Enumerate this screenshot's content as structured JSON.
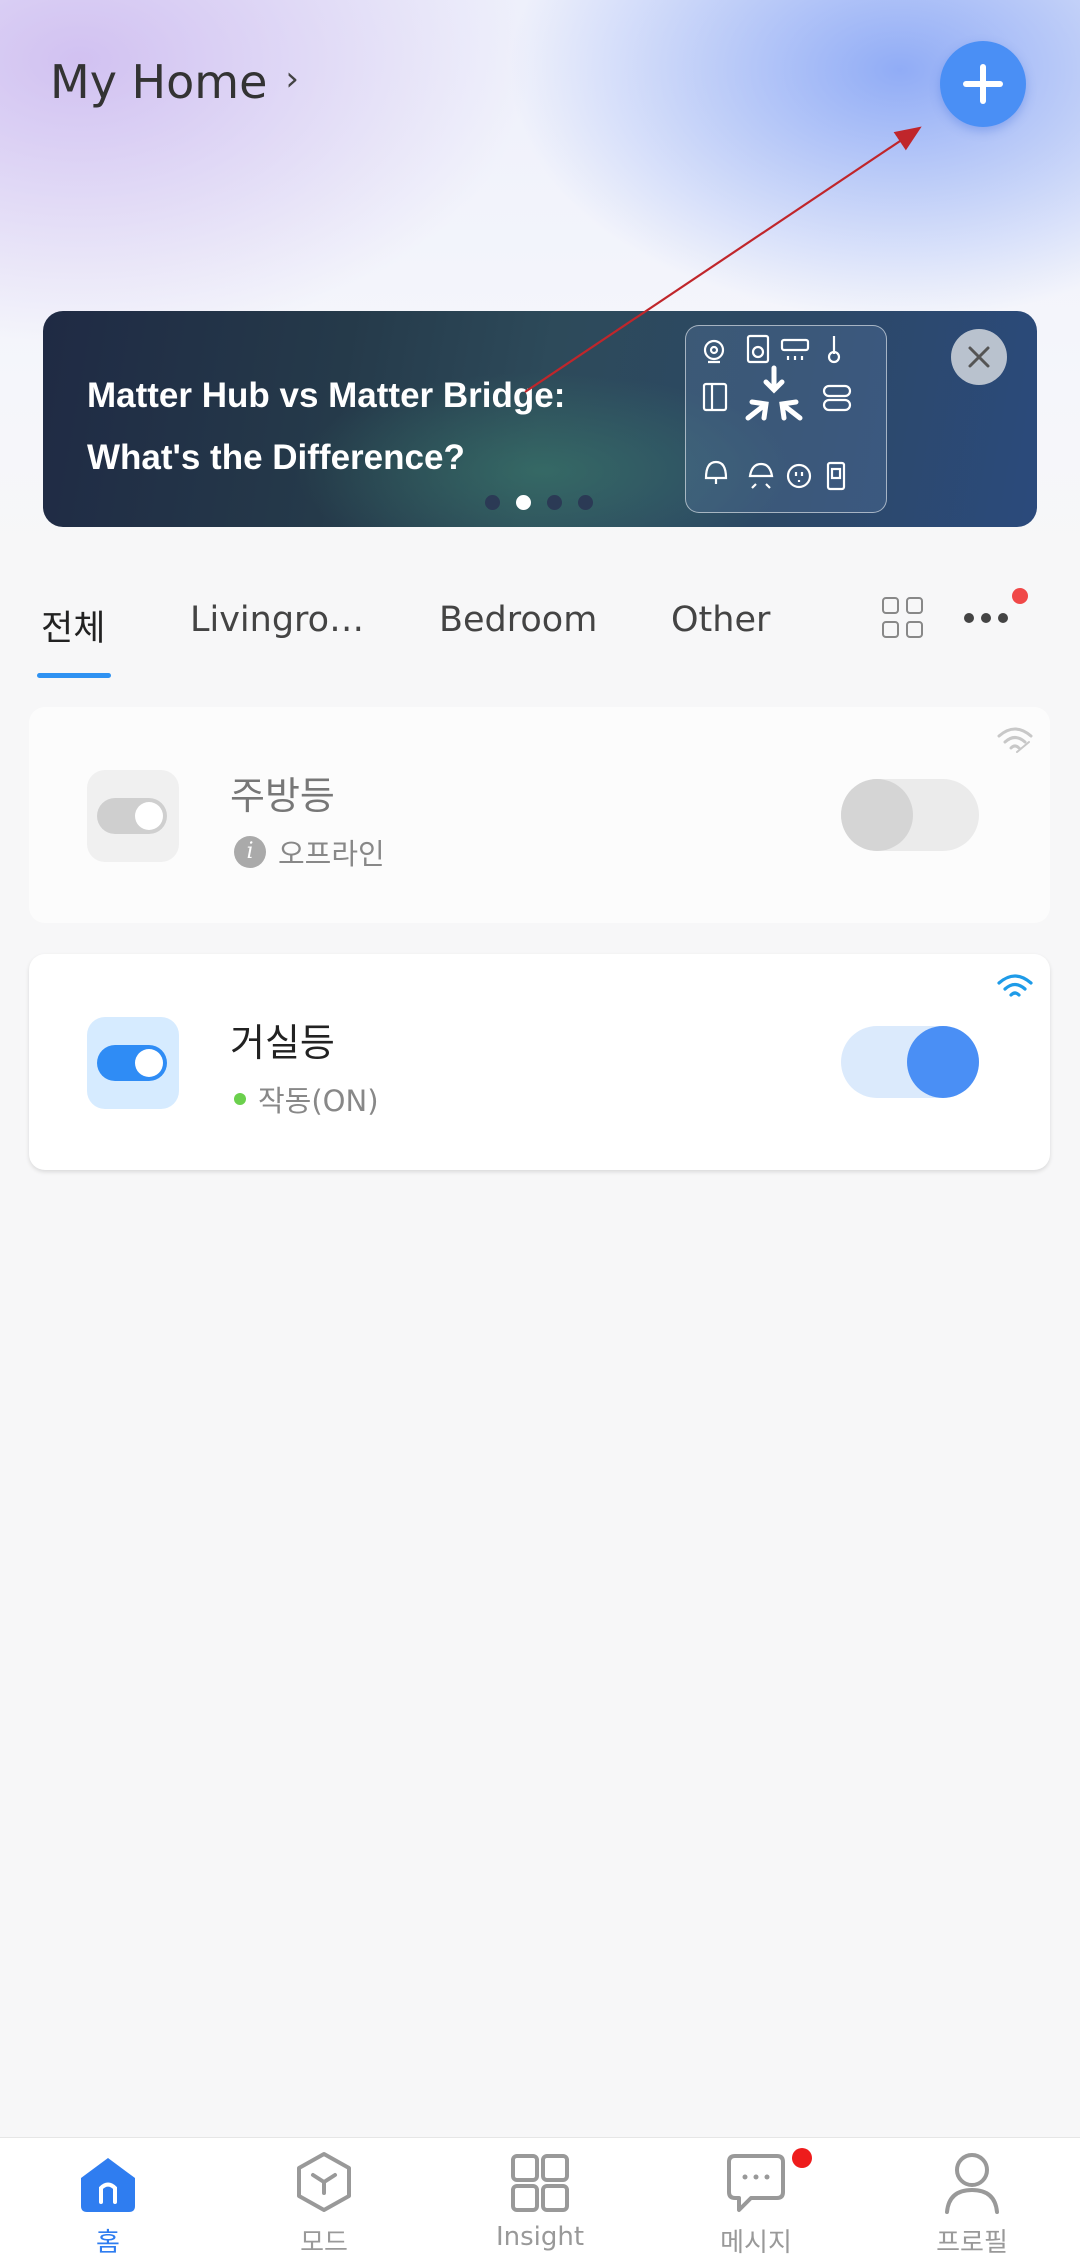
{
  "header": {
    "home_name": "My Home",
    "chevron": "›"
  },
  "banner": {
    "title_line1": "Matter Hub vs Matter Bridge:",
    "title_line2": "What's the Difference?",
    "page_count": 4,
    "active_page": 2
  },
  "tabs": {
    "items": [
      "전체",
      "Livingro…",
      "Bedroom",
      "Other"
    ],
    "active": "전체"
  },
  "devices": [
    {
      "name": "주방등",
      "status": "오프라인",
      "online": false,
      "on": false
    },
    {
      "name": "거실등",
      "status": "작동(ON)",
      "online": true,
      "on": true
    }
  ],
  "bottom_nav": {
    "items": [
      {
        "label": "홈",
        "icon": "home-icon",
        "active": true
      },
      {
        "label": "모드",
        "icon": "mode-cube-icon",
        "active": false
      },
      {
        "label": "Insight",
        "icon": "insight-grid-icon",
        "active": false
      },
      {
        "label": "메시지",
        "icon": "message-icon",
        "active": false
      },
      {
        "label": "프로필",
        "icon": "profile-icon",
        "active": false
      }
    ]
  },
  "colors": {
    "accent": "#4a8ff5",
    "tab_underline": "#2f92f2",
    "notification_dot": "#f04848",
    "online_dot": "#6bd04d"
  }
}
